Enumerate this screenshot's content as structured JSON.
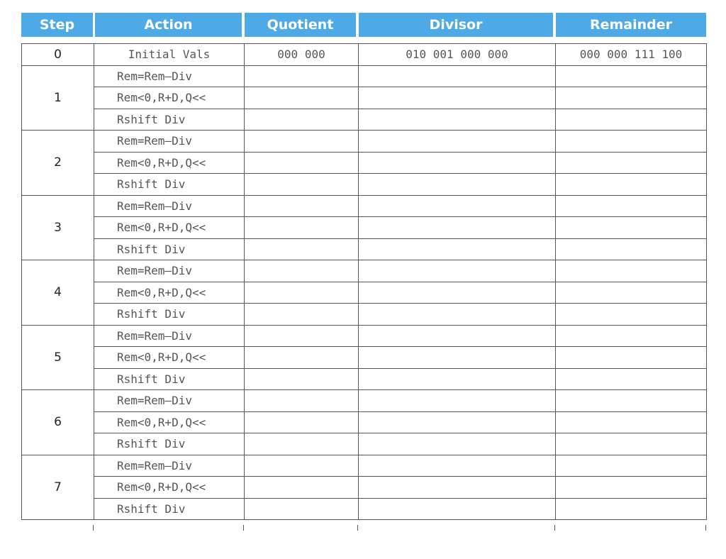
{
  "headers": {
    "step": "Step",
    "action": "Action",
    "quotient": "Quotient",
    "divisor": "Divisor",
    "remainder": "Remainder"
  },
  "initial": {
    "step": "0",
    "action": "Initial Vals",
    "quotient": "000 000",
    "divisor": "010 001 000 000",
    "remainder": "000 000 111 100"
  },
  "steps": [
    {
      "step": "1",
      "actions": [
        "Rem=Rem—Div",
        "Rem<0,R+D,Q<<",
        "Rshift Div"
      ]
    },
    {
      "step": "2",
      "actions": [
        "Rem=Rem—Div",
        "Rem<0,R+D,Q<<",
        "Rshift Div"
      ]
    },
    {
      "step": "3",
      "actions": [
        "Rem=Rem—Div",
        "Rem<0,R+D,Q<<",
        "Rshift Div"
      ]
    },
    {
      "step": "4",
      "actions": [
        "Rem=Rem—Div",
        "Rem<0,R+D,Q<<",
        "Rshift Div"
      ]
    },
    {
      "step": "5",
      "actions": [
        "Rem=Rem—Div",
        "Rem<0,R+D,Q<<",
        "Rshift Div"
      ]
    },
    {
      "step": "6",
      "actions": [
        "Rem=Rem—Div",
        "Rem<0,R+D,Q<<",
        "Rshift Div"
      ]
    },
    {
      "step": "7",
      "actions": [
        "Rem=Rem—Div",
        "Rem<0,R+D,Q<<",
        "Rshift Div"
      ]
    }
  ]
}
